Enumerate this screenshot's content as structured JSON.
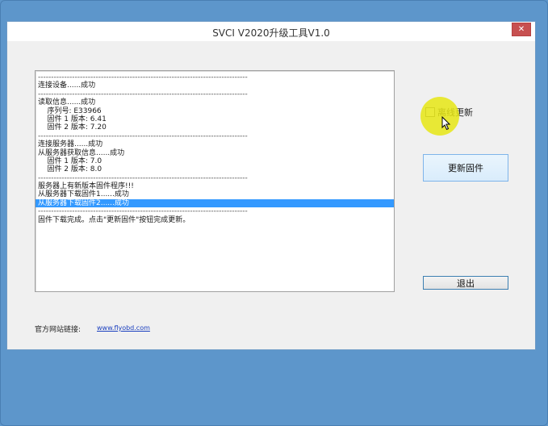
{
  "window": {
    "title": "SVCI V2020升级工具V1.0",
    "close_glyph": "✕"
  },
  "log": {
    "lines": [
      {
        "text": "--------------------------------------------------------------------------------",
        "kind": "sep"
      },
      {
        "text": "连接设备......成功",
        "kind": "text"
      },
      {
        "text": "--------------------------------------------------------------------------------",
        "kind": "sep"
      },
      {
        "text": "读取信息......成功",
        "kind": "text"
      },
      {
        "text": "    序列号: E33966",
        "kind": "text"
      },
      {
        "text": "    固件 1 版本: 6.41",
        "kind": "text"
      },
      {
        "text": "    固件 2 版本: 7.20",
        "kind": "text"
      },
      {
        "text": "--------------------------------------------------------------------------------",
        "kind": "sep"
      },
      {
        "text": "连接服务器......成功",
        "kind": "text"
      },
      {
        "text": "从服务器获取信息......成功",
        "kind": "text"
      },
      {
        "text": "    固件 1 版本: 7.0",
        "kind": "text"
      },
      {
        "text": "    固件 2 版本: 8.0",
        "kind": "text"
      },
      {
        "text": "--------------------------------------------------------------------------------",
        "kind": "sep"
      },
      {
        "text": "服务器上有新版本固件程序!!!",
        "kind": "text"
      },
      {
        "text": "从服务器下载固件1......成功",
        "kind": "text"
      },
      {
        "text": "从服务器下载固件2......成功",
        "kind": "selected"
      },
      {
        "text": "--------------------------------------------------------------------------------",
        "kind": "sep"
      },
      {
        "text": "固件下载完成。点击\"更新固件\"按钮完成更新。",
        "kind": "text"
      }
    ]
  },
  "controls": {
    "offline_update_label": "离线更新",
    "offline_update_checked": false,
    "update_firmware_label": "更新固件",
    "exit_label": "退出"
  },
  "footer": {
    "website_label": "官方网站链接:",
    "website_link": "www.flyobd.com"
  },
  "colors": {
    "desktop": "#5d96cb",
    "selection": "#3399ff",
    "close_button": "#c75050",
    "highlight": "#e6e614"
  }
}
